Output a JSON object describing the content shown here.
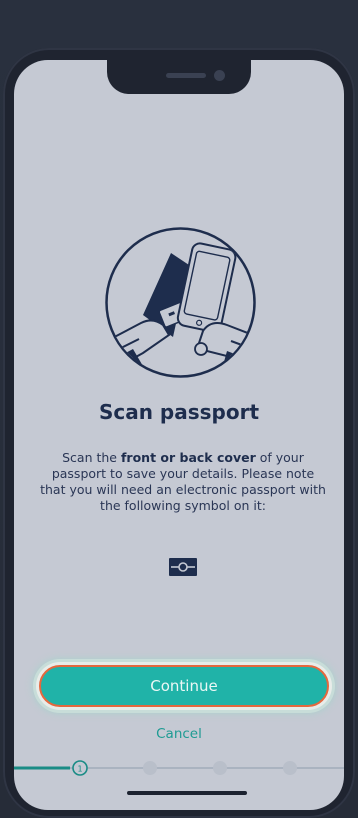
{
  "screen": {
    "title": "Scan passport",
    "description_prefix": "Scan the ",
    "description_bold": "front or back cover",
    "description_suffix": " of your passport to save your details. Please note that you will need an electronic passport with the following symbol on it:",
    "continue_label": "Continue",
    "cancel_label": "Cancel"
  },
  "progress": {
    "current_step_label": "1",
    "total_steps": 4,
    "current_step": 1
  },
  "icons": {
    "illustration": "hands-holding-phone-over-passport-illustration",
    "epassport_symbol": "epassport-chip-icon"
  },
  "colors": {
    "accent": "#20b3a8",
    "title": "#1e2d4d",
    "button_border": "#e4683e",
    "screen_bg": "#c5c9d3"
  }
}
